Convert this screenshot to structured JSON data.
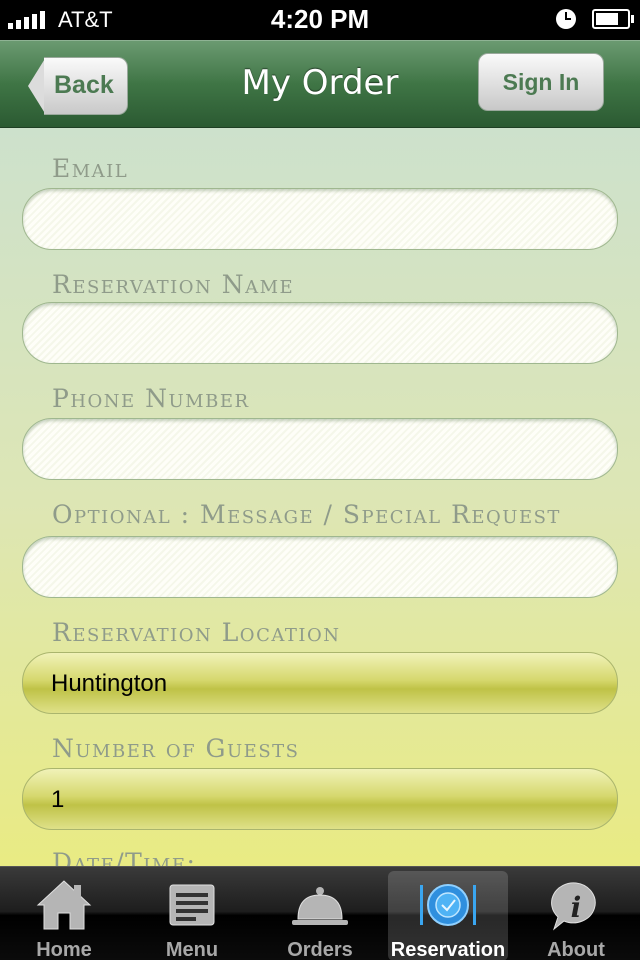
{
  "status_bar": {
    "carrier": "AT&T",
    "time": "4:20 PM"
  },
  "nav": {
    "title": "My Order",
    "back_label": "Back",
    "signin_label": "Sign In"
  },
  "form": {
    "email_label": "Email",
    "reservation_name_label": "Reservation Name",
    "phone_label": "Phone Number",
    "message_label": "Optional : Message / Special Request",
    "location_label": "Reservation Location",
    "location_value": "Huntington",
    "guests_label": "Number of Guests",
    "guests_value": "1",
    "datetime_label": "Date/Time:"
  },
  "tabs": [
    {
      "label": "Home",
      "icon": "home-icon"
    },
    {
      "label": "Menu",
      "icon": "menu-icon"
    },
    {
      "label": "Orders",
      "icon": "cloche-icon"
    },
    {
      "label": "Reservation",
      "icon": "plate-icon",
      "active": true
    },
    {
      "label": "About",
      "icon": "info-icon"
    }
  ],
  "colors": {
    "nav_green": "#3f7545",
    "label_gray": "#8f9b8a",
    "select_yellow": "#d6d86e"
  }
}
